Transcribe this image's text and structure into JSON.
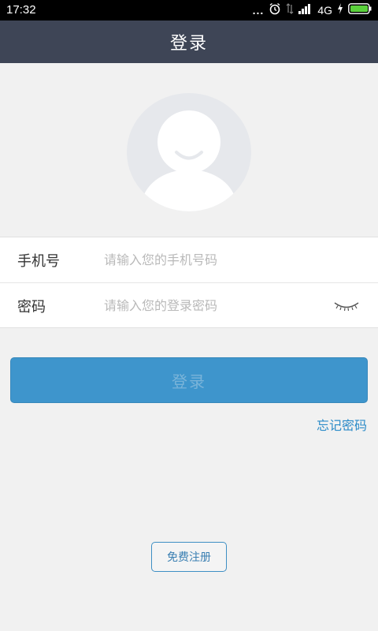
{
  "status_bar": {
    "time": "17:32",
    "dots": "...",
    "network": "4G",
    "icons": [
      "alarm-icon",
      "data-arrows-icon",
      "signal-icon",
      "charging-icon",
      "battery-icon"
    ]
  },
  "header": {
    "title": "登录"
  },
  "avatar": {
    "icon": "avatar-placeholder-icon"
  },
  "form": {
    "phone": {
      "label": "手机号",
      "placeholder": "请输入您的手机号码"
    },
    "password": {
      "label": "密码",
      "placeholder": "请输入您的登录密码",
      "toggle_icon": "eye-closed-icon"
    }
  },
  "login_button": {
    "label": "登录"
  },
  "forgot_password": {
    "label": "忘记密码"
  },
  "register_button": {
    "label": "免费注册"
  },
  "colors": {
    "header_bg": "#3e4556",
    "primary": "#3e95cc",
    "link": "#2b8bc8",
    "page_bg": "#f1f1f1"
  }
}
